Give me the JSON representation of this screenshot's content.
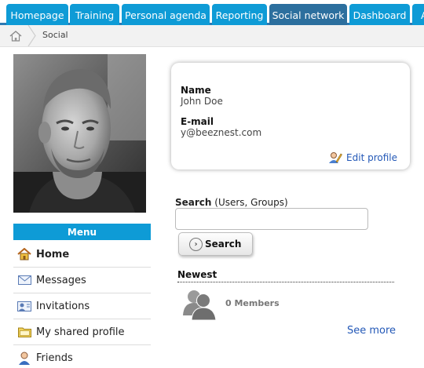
{
  "tabs": [
    {
      "label": "Homepage",
      "active": false
    },
    {
      "label": "Training",
      "active": false
    },
    {
      "label": "Personal agenda",
      "active": false
    },
    {
      "label": "Reporting",
      "active": false
    },
    {
      "label": "Social network",
      "active": true
    },
    {
      "label": "Dashboard",
      "active": false
    },
    {
      "label": "A",
      "active": false
    }
  ],
  "breadcrumb": {
    "current": "Social"
  },
  "menu": {
    "header": "Menu",
    "items": [
      {
        "label": "Home",
        "icon": "home-icon",
        "active": true
      },
      {
        "label": "Messages",
        "icon": "envelope-icon",
        "active": false
      },
      {
        "label": "Invitations",
        "icon": "invitation-icon",
        "active": false
      },
      {
        "label": "My shared profile",
        "icon": "folder-icon",
        "active": false
      },
      {
        "label": "Friends",
        "icon": "friend-icon",
        "active": false
      }
    ]
  },
  "profile": {
    "name_label": "Name",
    "name_value": "John Doe",
    "email_label": "E-mail",
    "email_value": "y@beeznest.com",
    "edit_label": "Edit profile"
  },
  "search": {
    "label_bold": "Search",
    "label_rest": " (Users, Groups)",
    "value": "",
    "button_label": "Search"
  },
  "newest": {
    "title": "Newest",
    "members": "0 Members",
    "see_more": "See more"
  },
  "colors": {
    "tab": "#0e9bd6",
    "tab_active": "#2c6f9e",
    "link": "#2358b7"
  }
}
